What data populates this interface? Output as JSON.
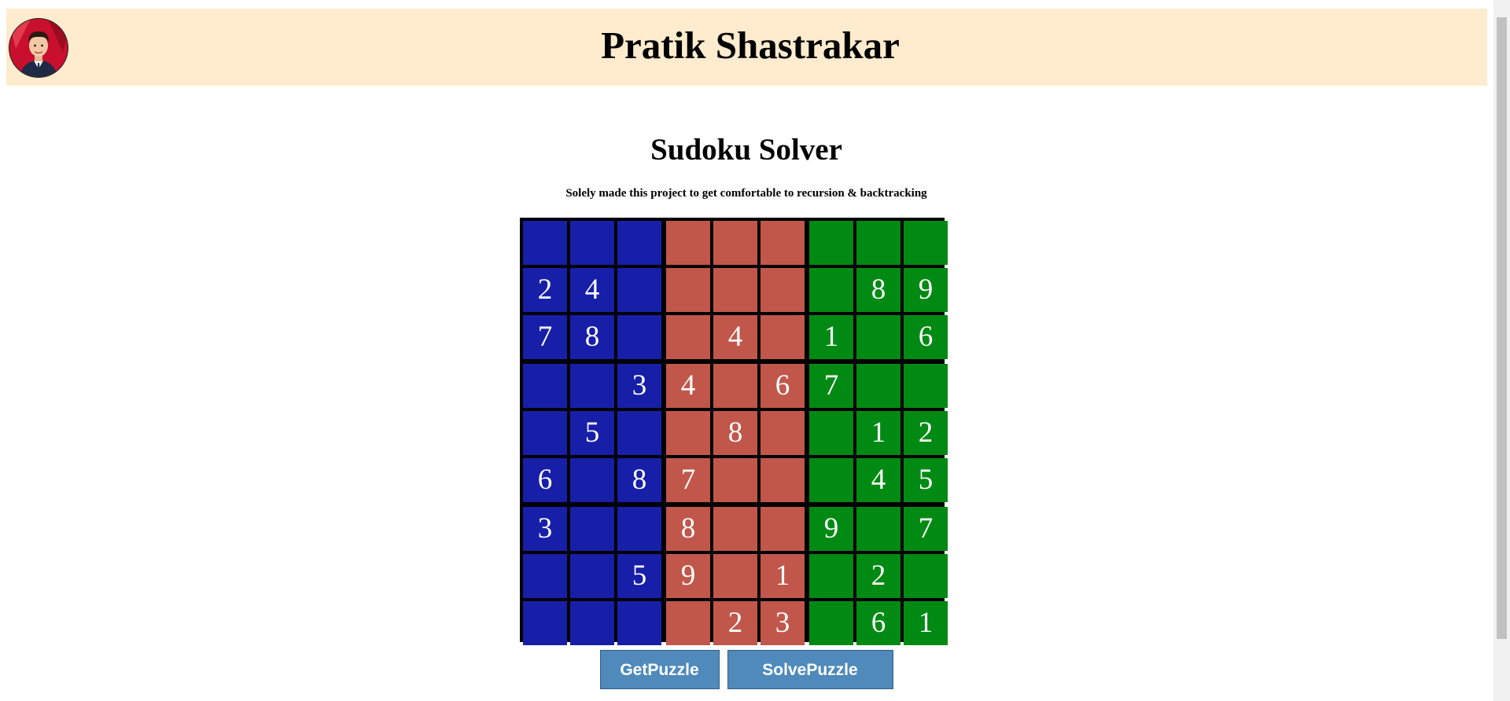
{
  "header": {
    "title": "Pratik Shastrakar",
    "avatar_colors": {
      "bg": "#c8102e",
      "skin": "#f3c9a5",
      "hair": "#2b1b12",
      "suit": "#1f2a44"
    }
  },
  "main": {
    "title": "Sudoku Solver",
    "subtitle": "Solely made this project to get comfortable to recursion & backtracking"
  },
  "board": {
    "column_colors": [
      "#171fa8",
      "#c1574b",
      "#008a13"
    ],
    "grid": [
      [
        "",
        "",
        "",
        "",
        "",
        "",
        "",
        "",
        ""
      ],
      [
        "2",
        "4",
        "",
        "",
        "",
        "",
        "",
        "8",
        "9"
      ],
      [
        "7",
        "8",
        "",
        "",
        "4",
        "",
        "1",
        "",
        "6"
      ],
      [
        "",
        "",
        "3",
        "4",
        "",
        "6",
        "7",
        "",
        ""
      ],
      [
        "",
        "5",
        "",
        "",
        "8",
        "",
        "",
        "1",
        "2"
      ],
      [
        "6",
        "",
        "8",
        "7",
        "",
        "",
        "",
        "4",
        "5"
      ],
      [
        "3",
        "",
        "",
        "8",
        "",
        "",
        "9",
        "",
        "7"
      ],
      [
        "",
        "",
        "5",
        "9",
        "",
        "1",
        "",
        "2",
        ""
      ],
      [
        "",
        "",
        "",
        "",
        "2",
        "3",
        "",
        "6",
        "1"
      ]
    ]
  },
  "buttons": {
    "get_label": "GetPuzzle",
    "solve_label": "SolvePuzzle"
  }
}
